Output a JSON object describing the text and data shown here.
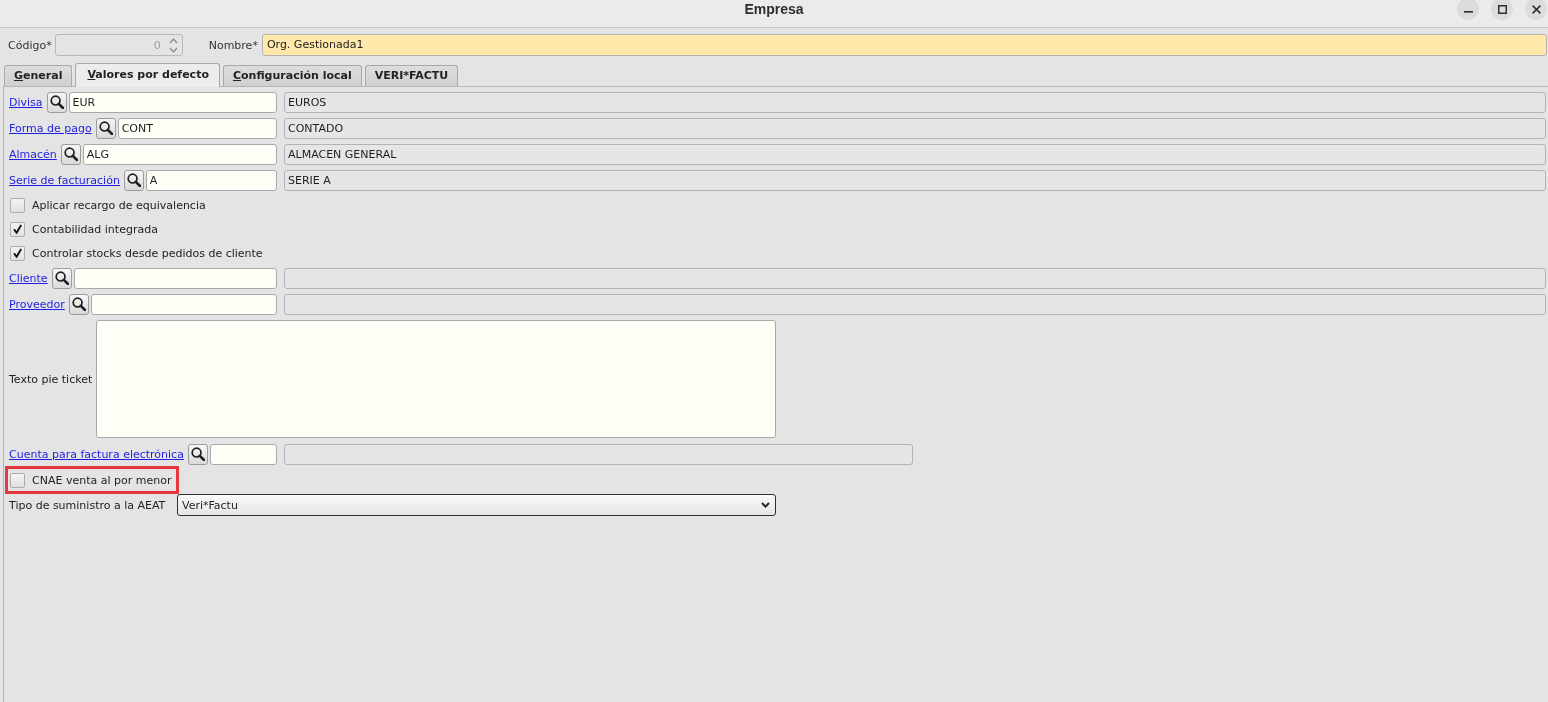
{
  "window": {
    "title": "Empresa",
    "controls": [
      {
        "kind": "minimize"
      },
      {
        "kind": "maximize"
      },
      {
        "kind": "close"
      }
    ]
  },
  "header": {
    "code": {
      "label": "Código*",
      "value": "0",
      "disabled": true
    },
    "name": {
      "label": "Nombre*",
      "value": "Org. Gestionada1"
    }
  },
  "tabs": [
    {
      "label": "General",
      "selected": false,
      "mnemonic": true
    },
    {
      "label": "Valores por defecto",
      "selected": true,
      "mnemonic": true
    },
    {
      "label": "Configuración local",
      "selected": false,
      "mnemonic": true
    },
    {
      "label": "VERI*FACTU",
      "selected": false,
      "mnemonic": false
    }
  ],
  "fields": [
    {
      "kind": "lookup",
      "label": "Divisa",
      "value": "EUR",
      "description": "EUROS"
    },
    {
      "kind": "lookup",
      "label": "Forma de pago",
      "value": "CONT",
      "description": "CONTADO"
    },
    {
      "kind": "lookup",
      "label": "Almacén",
      "value": "ALG",
      "description": "ALMACEN GENERAL"
    },
    {
      "kind": "lookup",
      "label": "Serie de facturación",
      "value": "A",
      "description": "SERIE A"
    },
    {
      "kind": "checkbox",
      "label": "Aplicar recargo de equivalencia",
      "checked": false,
      "highlighted": false
    },
    {
      "kind": "checkbox",
      "label": "Contabilidad integrada",
      "checked": true,
      "highlighted": false
    },
    {
      "kind": "checkbox",
      "label": "Controlar stocks desde pedidos de cliente",
      "checked": true,
      "highlighted": false
    },
    {
      "kind": "lookup",
      "label": "Cliente"
    },
    {
      "kind": "lookup",
      "label": "Proveedor"
    },
    {
      "kind": "textarea",
      "label": "Texto pie ticket"
    },
    {
      "kind": "compactlookup",
      "label": "Cuenta para factura electrónica"
    },
    {
      "kind": "checkbox",
      "label": "CNAE venta al por menor",
      "checked": false,
      "highlighted": true
    },
    {
      "kind": "select",
      "label": "Tipo de suministro a la AEAT",
      "value": "Veri*Factu"
    }
  ]
}
